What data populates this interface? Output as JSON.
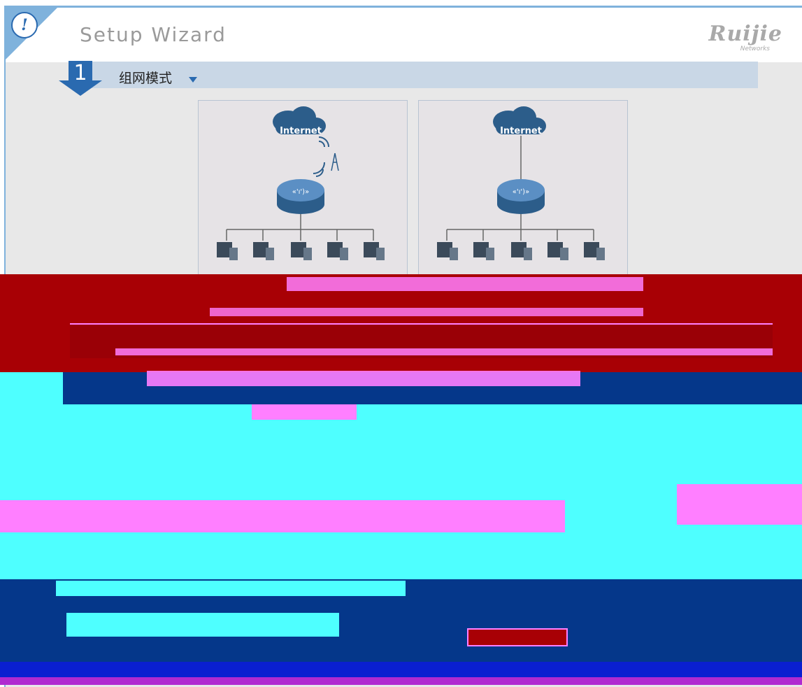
{
  "header": {
    "title": "Setup Wizard",
    "brand": "Ruijie",
    "brand_sub": "Networks",
    "alert_glyph": "!"
  },
  "step": {
    "number": "1",
    "label": "组网模式"
  },
  "panels": [
    {
      "cloud_label": "Internet",
      "link": "wireless",
      "clients": 5
    },
    {
      "cloud_label": "Internet",
      "link": "wired",
      "clients": 5
    }
  ],
  "colors": {
    "accent": "#2a6ab0",
    "frame": "#7fb2dc",
    "glitch_red": "#a80005",
    "glitch_cyan": "#4effff",
    "glitch_navy": "#05378a",
    "glitch_pink": "#ff7fff"
  }
}
